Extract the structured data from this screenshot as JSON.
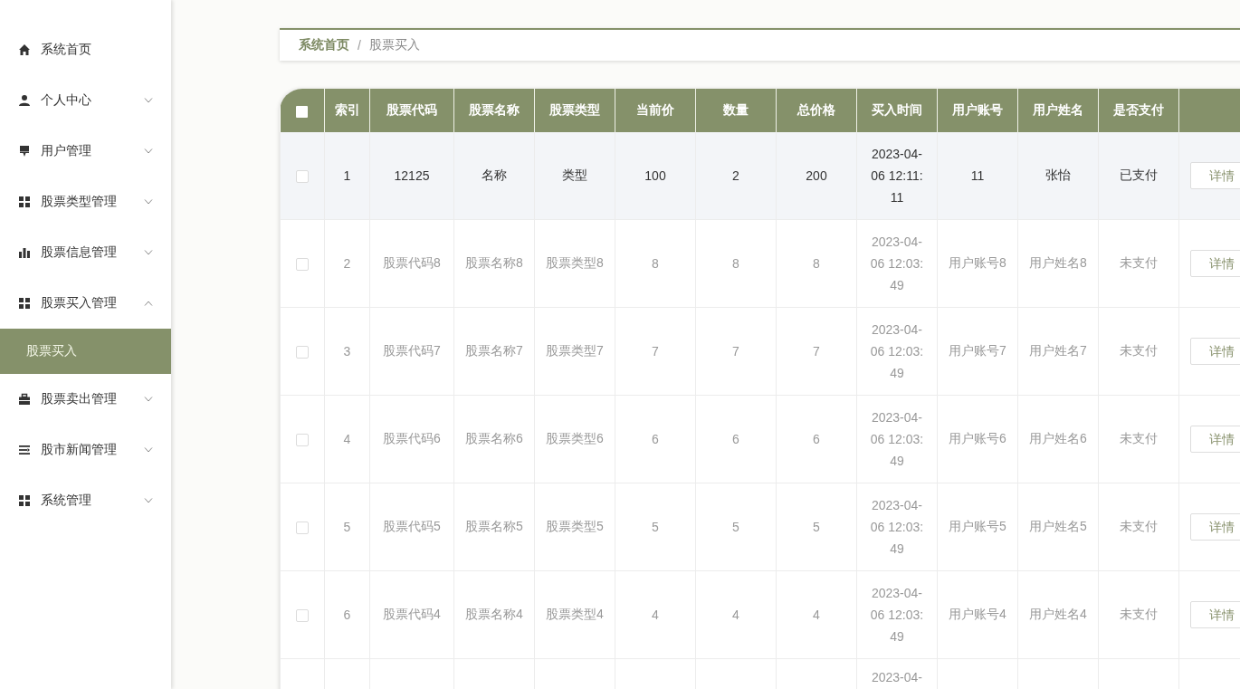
{
  "sidebar": {
    "items": [
      {
        "label": "系统首页",
        "kind": "home"
      },
      {
        "label": "个人中心",
        "kind": "user",
        "expanded": false
      },
      {
        "label": "用户管理",
        "kind": "brush",
        "expanded": false
      },
      {
        "label": "股票类型管理",
        "kind": "grid",
        "expanded": false
      },
      {
        "label": "股票信息管理",
        "kind": "chart",
        "expanded": false
      },
      {
        "label": "股票买入管理",
        "kind": "grid",
        "expanded": true,
        "children": [
          {
            "label": "股票买入",
            "selected": true
          }
        ]
      },
      {
        "label": "股票卖出管理",
        "kind": "briefcase",
        "expanded": false
      },
      {
        "label": "股市新闻管理",
        "kind": "list",
        "expanded": false
      },
      {
        "label": "系统管理",
        "kind": "grid",
        "expanded": false
      }
    ]
  },
  "breadcrumb": [
    {
      "label": "系统首页"
    },
    {
      "label": "股票买入"
    }
  ],
  "breadcrumb_separator": "/",
  "table": {
    "header_checked": false,
    "columns": [
      "索引",
      "股票代码",
      "股票名称",
      "股票类型",
      "当前价",
      "数量",
      "总价格",
      "买入时间",
      "用户账号",
      "用户姓名",
      "是否支付"
    ],
    "rows": [
      {
        "checked": false,
        "highlighted": true,
        "cells": [
          "1",
          "12125",
          "名称",
          "类型",
          "100",
          "2",
          "200",
          "2023-04-06 12:11:11",
          "11",
          "张怡",
          "已支付"
        ],
        "action": "详情"
      },
      {
        "checked": false,
        "highlighted": false,
        "cells": [
          "2",
          "股票代码8",
          "股票名称8",
          "股票类型8",
          "8",
          "8",
          "8",
          "2023-04-06 12:03:49",
          "用户账号8",
          "用户姓名8",
          "未支付"
        ],
        "action": "详情"
      },
      {
        "checked": false,
        "highlighted": false,
        "cells": [
          "3",
          "股票代码7",
          "股票名称7",
          "股票类型7",
          "7",
          "7",
          "7",
          "2023-04-06 12:03:49",
          "用户账号7",
          "用户姓名7",
          "未支付"
        ],
        "action": "详情"
      },
      {
        "checked": false,
        "highlighted": false,
        "cells": [
          "4",
          "股票代码6",
          "股票名称6",
          "股票类型6",
          "6",
          "6",
          "6",
          "2023-04-06 12:03:49",
          "用户账号6",
          "用户姓名6",
          "未支付"
        ],
        "action": "详情"
      },
      {
        "checked": false,
        "highlighted": false,
        "cells": [
          "5",
          "股票代码5",
          "股票名称5",
          "股票类型5",
          "5",
          "5",
          "5",
          "2023-04-06 12:03:49",
          "用户账号5",
          "用户姓名5",
          "未支付"
        ],
        "action": "详情"
      },
      {
        "checked": false,
        "highlighted": false,
        "cells": [
          "6",
          "股票代码4",
          "股票名称4",
          "股票类型4",
          "4",
          "4",
          "4",
          "2023-04-06 12:03:49",
          "用户账号4",
          "用户姓名4",
          "未支付"
        ],
        "action": "详情"
      },
      {
        "partial_time": "2023-04-"
      }
    ]
  }
}
